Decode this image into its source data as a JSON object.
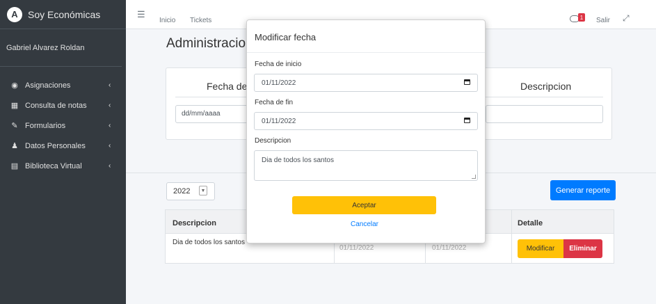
{
  "sidebar": {
    "brand_logo": "A",
    "brand": "Soy Económicas",
    "user": "Gabriel Alvarez Roldan",
    "items": [
      {
        "label": "Asignaciones",
        "icon": "tachometer-icon"
      },
      {
        "label": "Consulta de notas",
        "icon": "grid-icon"
      },
      {
        "label": "Formularios",
        "icon": "edit-icon"
      },
      {
        "label": "Datos Personales",
        "icon": "user-icon"
      },
      {
        "label": "Biblioteca Virtual",
        "icon": "book-icon"
      }
    ]
  },
  "topbar": {
    "links": [
      "Inicio",
      "Tickets"
    ],
    "badge_count": "1",
    "logout": "Salir"
  },
  "page": {
    "title": "Administracion",
    "form_headers": [
      "Fecha de I",
      "Descripcion"
    ],
    "date_placeholder": "dd/mm/aaaa",
    "year": "2022",
    "generate_button": "Generar reporte"
  },
  "table": {
    "columns": [
      "Descripcion",
      "Detalle"
    ],
    "rows": [
      {
        "descripcion": "Dia de todos los santos",
        "fecha_inicio": "01/11/2022",
        "fecha_fin": "01/11/2022"
      }
    ],
    "modify_button": "Modificar",
    "delete_button": "Eliminar"
  },
  "modal": {
    "title": "Modificar fecha",
    "start_label": "Fecha de inicio",
    "start_value": "01/11/2022",
    "end_label": "Fecha de fin",
    "end_value": "01/11/2022",
    "desc_label": "Descripcion",
    "desc_value": "Dia de todos los santos",
    "accept": "Aceptar",
    "cancel": "Cancelar"
  },
  "colors": {
    "sidebar": "#343a40",
    "primary": "#007bff",
    "warning": "#ffc107",
    "danger": "#dc3545"
  }
}
